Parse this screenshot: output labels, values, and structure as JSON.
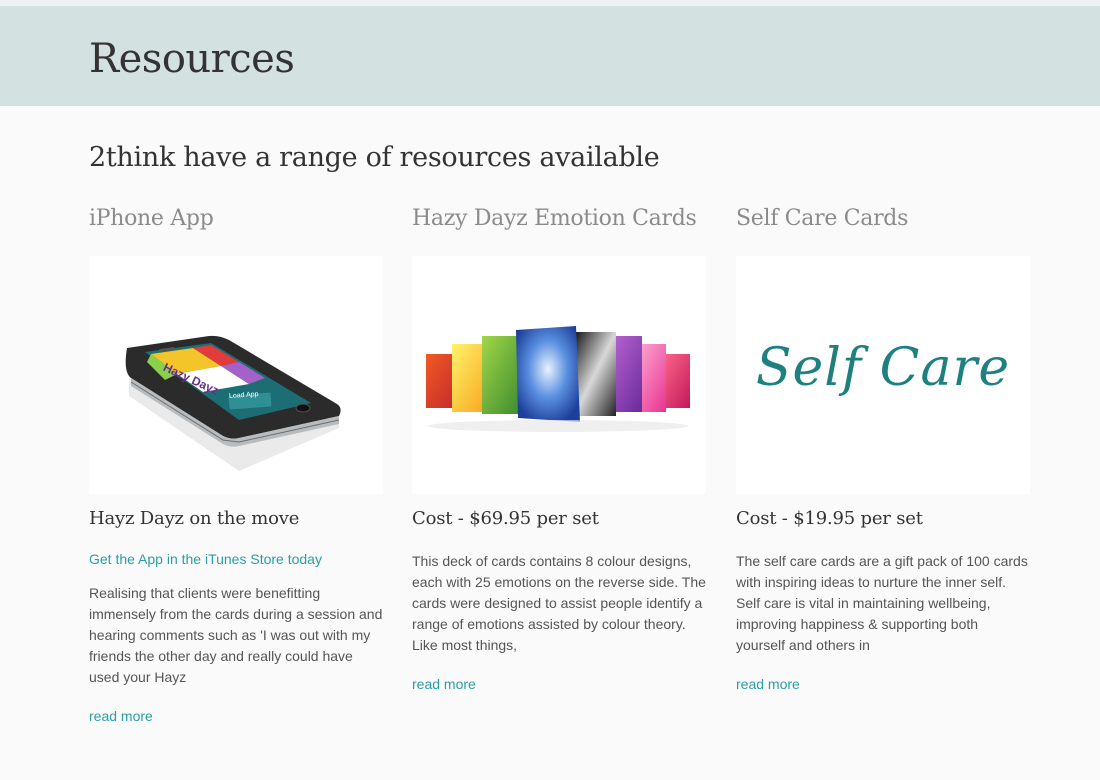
{
  "header": {
    "title": "Resources"
  },
  "main": {
    "subtitle": "2think have a range of resources available",
    "columns": [
      {
        "heading": "iPhone App",
        "image_icon": "phone-app-image",
        "phone_screen_text": "Hazy Dayz",
        "phone_button_text": "Load App",
        "item_title": "Hayz Dayz on the move",
        "store_link": "Get the App in the iTunes Store today",
        "description": "Realising that clients were benefitting immensely from the cards during a session and hearing comments such as 'I was out with my friends the other day and really could have used your Hayz",
        "read_more": "read more"
      },
      {
        "heading": "Hazy Dayz Emotion Cards",
        "image_icon": "emotion-cards-image",
        "item_title": "Cost - $69.95 per set",
        "description": "This deck of cards contains 8 colour designs, each with 25 emotions on the reverse side. The cards were designed to assist people identify a range of emotions assisted by colour theory. Like most things,",
        "read_more": "read more"
      },
      {
        "heading": "Self Care Cards",
        "image_icon": "self-care-logo-image",
        "logo_text": "Self Care",
        "item_title": "Cost - $19.95 per set",
        "description": "The self care cards are a gift pack of 100 cards with inspiring ideas to nurture the inner self. Self care is vital in maintaining wellbeing, improving happiness & supporting both yourself and others in",
        "read_more": "read more"
      }
    ]
  },
  "colors": {
    "header_bg": "#d4e1e1",
    "link": "#2a9fa3",
    "heading_grey": "#8b8b8b",
    "logo_teal": "#1f8080"
  }
}
